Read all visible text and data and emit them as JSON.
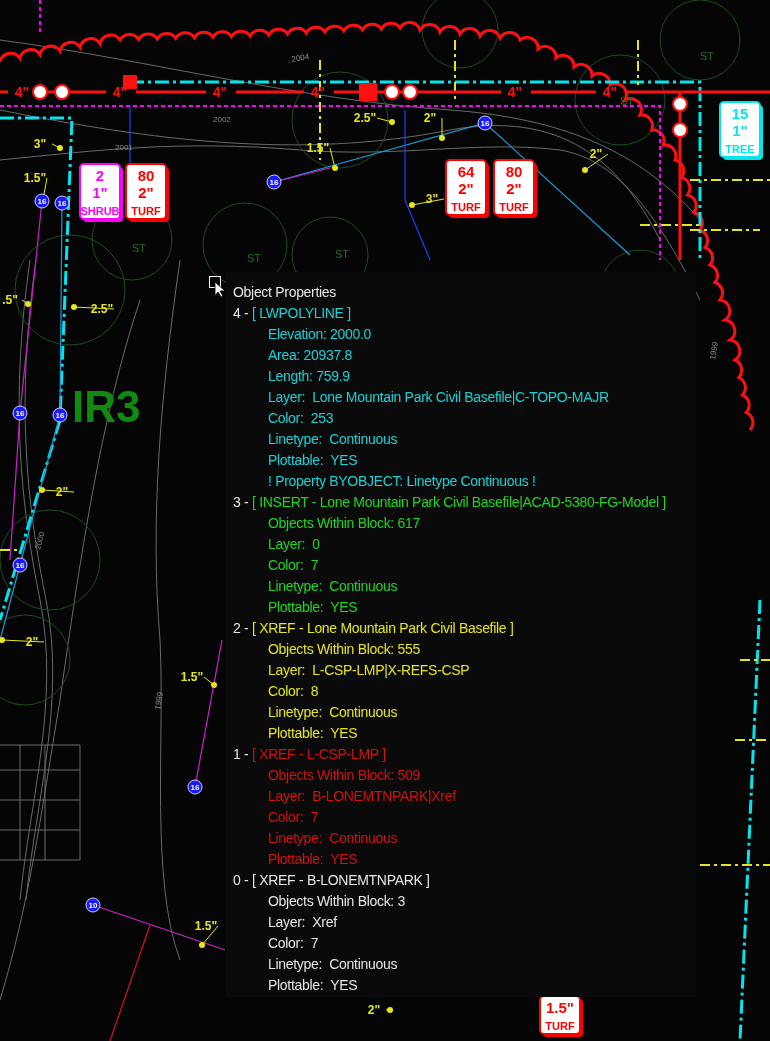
{
  "drawing": {
    "main_pipe_sizes": [
      "4\"",
      "4\"",
      "4\"",
      "4\"",
      "4\"",
      "4\""
    ],
    "lateral_sizes": [
      "3\"",
      "1.5\"",
      "2.5\"",
      "2\"",
      "1.5\"",
      "3\"",
      "2\"",
      ".5\"",
      "2.5\"",
      "2\"",
      "2\"",
      "1.5\"",
      "1.5\"",
      "2\""
    ],
    "nodes": [
      "16",
      "16",
      "16",
      "16",
      "16",
      "16",
      "16",
      "16",
      "10"
    ],
    "tags": [
      {
        "lines": [
          "2",
          "1\"",
          "SHRUB"
        ],
        "color": "#ff00ff"
      },
      {
        "lines": [
          "80",
          "2\"",
          "TURF"
        ],
        "color": "#ff0000"
      },
      {
        "lines": [
          "64",
          "2\"",
          "TURF"
        ],
        "color": "#ff0000"
      },
      {
        "lines": [
          "80",
          "2\"",
          "TURF"
        ],
        "color": "#ff0000"
      },
      {
        "lines": [
          "15",
          "1\"",
          "TREE"
        ],
        "color": "#00e5ee"
      },
      {
        "lines": [
          "1.5\"",
          "TURF"
        ],
        "color": "#ff0000"
      }
    ],
    "zone_label": "IR3",
    "contour_labels": [
      "2001",
      "2002",
      "2004",
      "1999",
      "1999",
      "2000"
    ],
    "tree_labels": [
      "ST",
      "ST",
      "ST",
      "ST",
      "ST"
    ]
  },
  "tooltip": {
    "title": "Object Properties",
    "entries": [
      {
        "index": "4 - ",
        "header": "[ LWPOLYLINE ]",
        "color": "#19d2d6",
        "lines": [
          "Elevation: 2000.0",
          "Area: 20937.8",
          "Length: 759.9",
          "Layer:  Lone Mountain Park Civil Basefile|C-TOPO-MAJR",
          "Color:  253",
          "Linetype:  Continuous",
          "Plottable:  YES",
          "! Property BYOBJECT: Linetype Continuous !"
        ]
      },
      {
        "index": "3 - ",
        "header": "[ INSERT - Lone Mountain Park Civil Basefile|ACAD-5380-FG-Model ]",
        "color": "#1ed81e",
        "lines": [
          "Objects Within Block: 617",
          "Layer:  0",
          "Color:  7",
          "Linetype:  Continuous",
          "Plottable:  YES"
        ]
      },
      {
        "index": "2 - ",
        "header": "[ XREF - Lone Mountain Park Civil Basefile ]",
        "color": "#e6e61c",
        "lines": [
          "Objects Within Block: 555",
          "Layer:  L-CSP-LMP|X-REFS-CSP",
          "Color:  8",
          "Linetype:  Continuous",
          "Plottable:  YES"
        ]
      },
      {
        "index": "1 - ",
        "header": "[ XREF - L-CSP-LMP ]",
        "color": "#d01212",
        "lines": [
          "Objects Within Block: 509",
          "Layer:  B-LONEMTNPARK|Xref",
          "Color:  7",
          "Linetype:  Continuous",
          "Plottable:  YES"
        ]
      },
      {
        "index": "0 - ",
        "header": "[ XREF - B-LONEMTNPARK ]",
        "color": "#e6e6e6",
        "lines": [
          "Objects Within Block: 3",
          "Layer:  Xref",
          "Color:  7",
          "Linetype:  Continuous",
          "Plottable:  YES"
        ]
      }
    ]
  }
}
